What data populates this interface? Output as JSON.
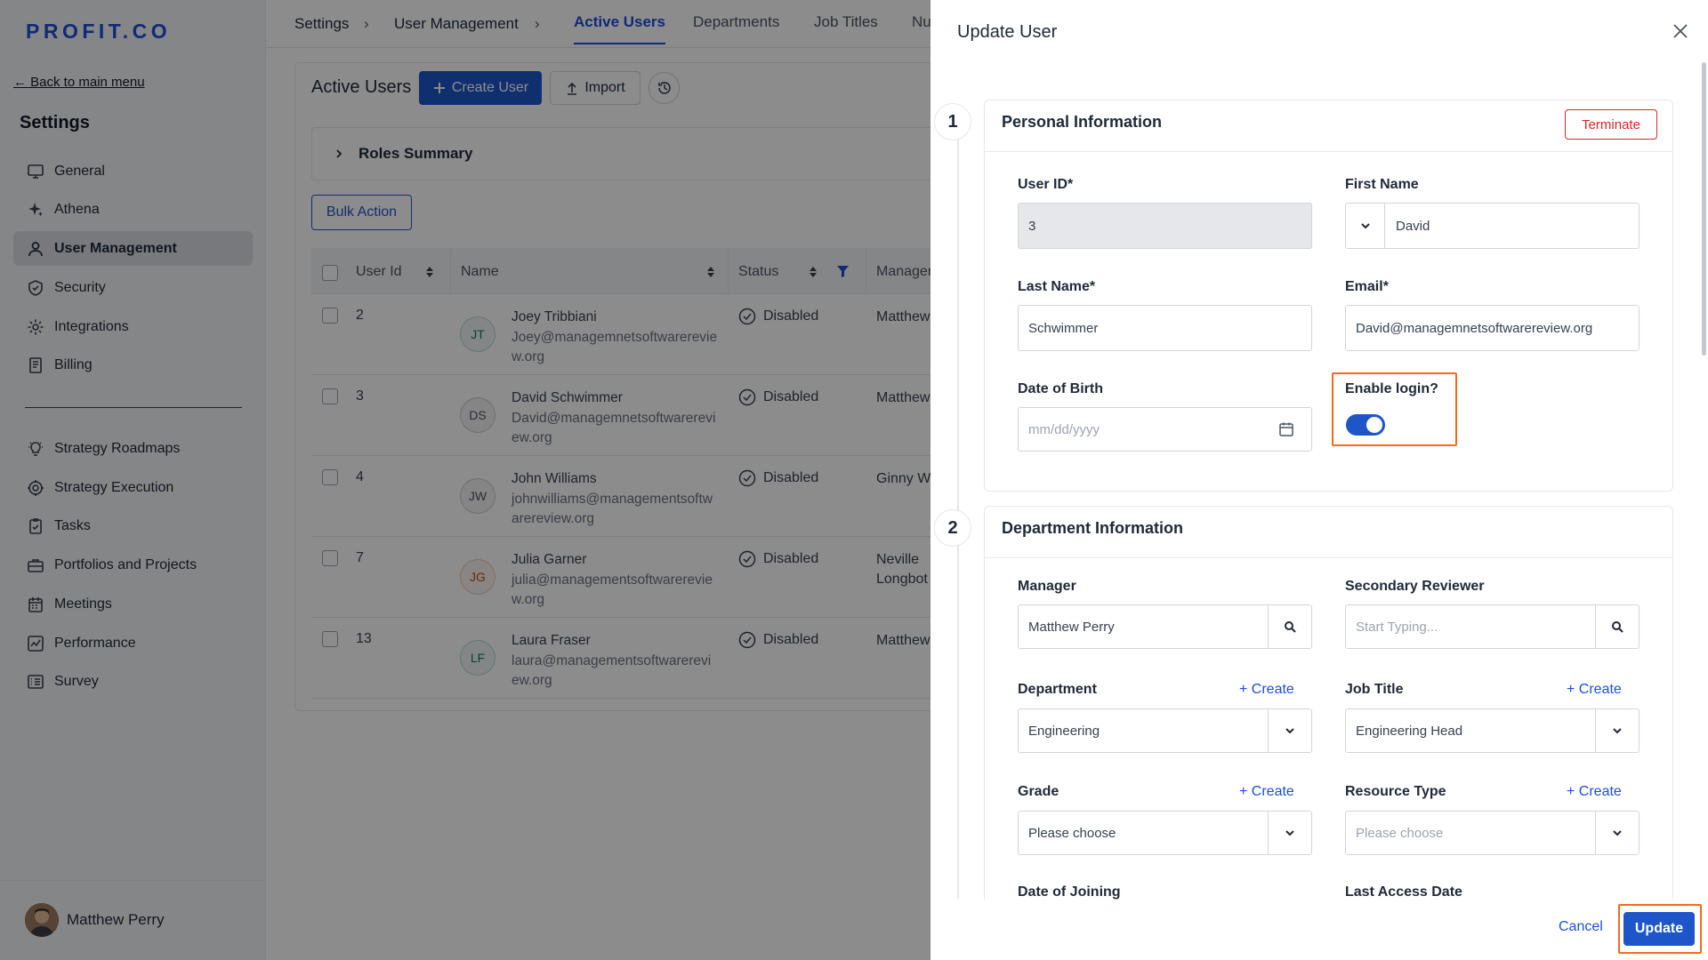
{
  "app": {
    "logo": "PROFIT.CO"
  },
  "sidebar": {
    "back_label": "← Back to main menu",
    "title": "Settings",
    "items": [
      {
        "label": "General",
        "icon": "monitor-icon"
      },
      {
        "label": "Athena",
        "icon": "sparkle-icon"
      },
      {
        "label": "User Management",
        "icon": "user-icon",
        "active": true
      },
      {
        "label": "Security",
        "icon": "shield-icon"
      },
      {
        "label": "Integrations",
        "icon": "gear-icon"
      },
      {
        "label": "Billing",
        "icon": "receipt-icon"
      }
    ],
    "items2": [
      {
        "label": "Strategy Roadmaps",
        "icon": "bulb-icon"
      },
      {
        "label": "Strategy Execution",
        "icon": "target-icon"
      },
      {
        "label": "Tasks",
        "icon": "clipboard-check-icon"
      },
      {
        "label": "Portfolios and Projects",
        "icon": "briefcase-icon"
      },
      {
        "label": "Meetings",
        "icon": "calendar-icon"
      },
      {
        "label": "Performance",
        "icon": "chart-icon"
      },
      {
        "label": "Survey",
        "icon": "survey-icon"
      }
    ],
    "user_name": "Matthew Perry"
  },
  "topbar": {
    "breadcrumbs": [
      "Settings",
      "User Management"
    ],
    "tabs": [
      "Active Users",
      "Departments",
      "Job Titles",
      "Nu"
    ]
  },
  "main": {
    "title": "Active Users",
    "create_user_label": "Create User",
    "import_label": "Import",
    "roles_summary_label": "Roles Summary",
    "bulk_action_label": "Bulk Action",
    "columns": [
      "User Id",
      "Name",
      "Status",
      "Manager"
    ],
    "rows": [
      {
        "id": "2",
        "initials": "JT",
        "name": "Joey Tribbiani",
        "email": "Joey@managemnetsoftwarereview.org",
        "status": "Disabled",
        "manager": "Matthew"
      },
      {
        "id": "3",
        "initials": "DS",
        "name": "David Schwimmer",
        "email": "David@managemnetsoftwarereview.org",
        "status": "Disabled",
        "manager": "Matthew"
      },
      {
        "id": "4",
        "initials": "JW",
        "name": "John Williams",
        "email": "johnwilliams@managementsoftwarereview.org",
        "status": "Disabled",
        "manager": "Ginny We"
      },
      {
        "id": "7",
        "initials": "JG",
        "name": "Julia Garner",
        "email": "julia@managementsoftwarereview.org",
        "status": "Disabled",
        "manager": "Neville Longbot"
      },
      {
        "id": "13",
        "initials": "LF",
        "name": "Laura Fraser",
        "email": "laura@managementsoftwarereview.org",
        "status": "Disabled",
        "manager": "Matthew"
      }
    ],
    "avatar_colors": [
      "#0f766e",
      "#475569",
      "#475569",
      "#b45309",
      "#0f766e"
    ]
  },
  "drawer": {
    "title": "Update User",
    "section1": {
      "step": "1",
      "title": "Personal Information",
      "terminate_label": "Terminate",
      "user_id_label": "User ID*",
      "user_id_value": "3",
      "first_name_label": "First Name",
      "first_name_value": "David",
      "last_name_label": "Last Name*",
      "last_name_value": "Schwimmer",
      "email_label": "Email*",
      "email_value": "David@managemnetsoftwarereview.org",
      "dob_label": "Date of Birth",
      "dob_placeholder": "mm/dd/yyyy",
      "enable_login_label": "Enable login?",
      "enable_login_on": true
    },
    "section2": {
      "step": "2",
      "title": "Department Information",
      "manager_label": "Manager",
      "manager_value": "Matthew Perry",
      "secondary_reviewer_label": "Secondary Reviewer",
      "secondary_reviewer_placeholder": "Start Typing...",
      "department_label": "Department",
      "department_value": "Engineering",
      "job_title_label": "Job Title",
      "job_title_value": "Engineering Head",
      "grade_label": "Grade",
      "grade_value": "Please choose",
      "resource_type_label": "Resource Type",
      "resource_type_placeholder": "Please choose",
      "date_of_joining_label": "Date of Joining",
      "last_access_label": "Last Access Date",
      "create_label": "+ Create"
    },
    "cancel_label": "Cancel",
    "update_label": "Update"
  },
  "colors": {
    "accent": "#1e56c9",
    "highlight": "#f26c1d",
    "danger": "#dc2626"
  }
}
